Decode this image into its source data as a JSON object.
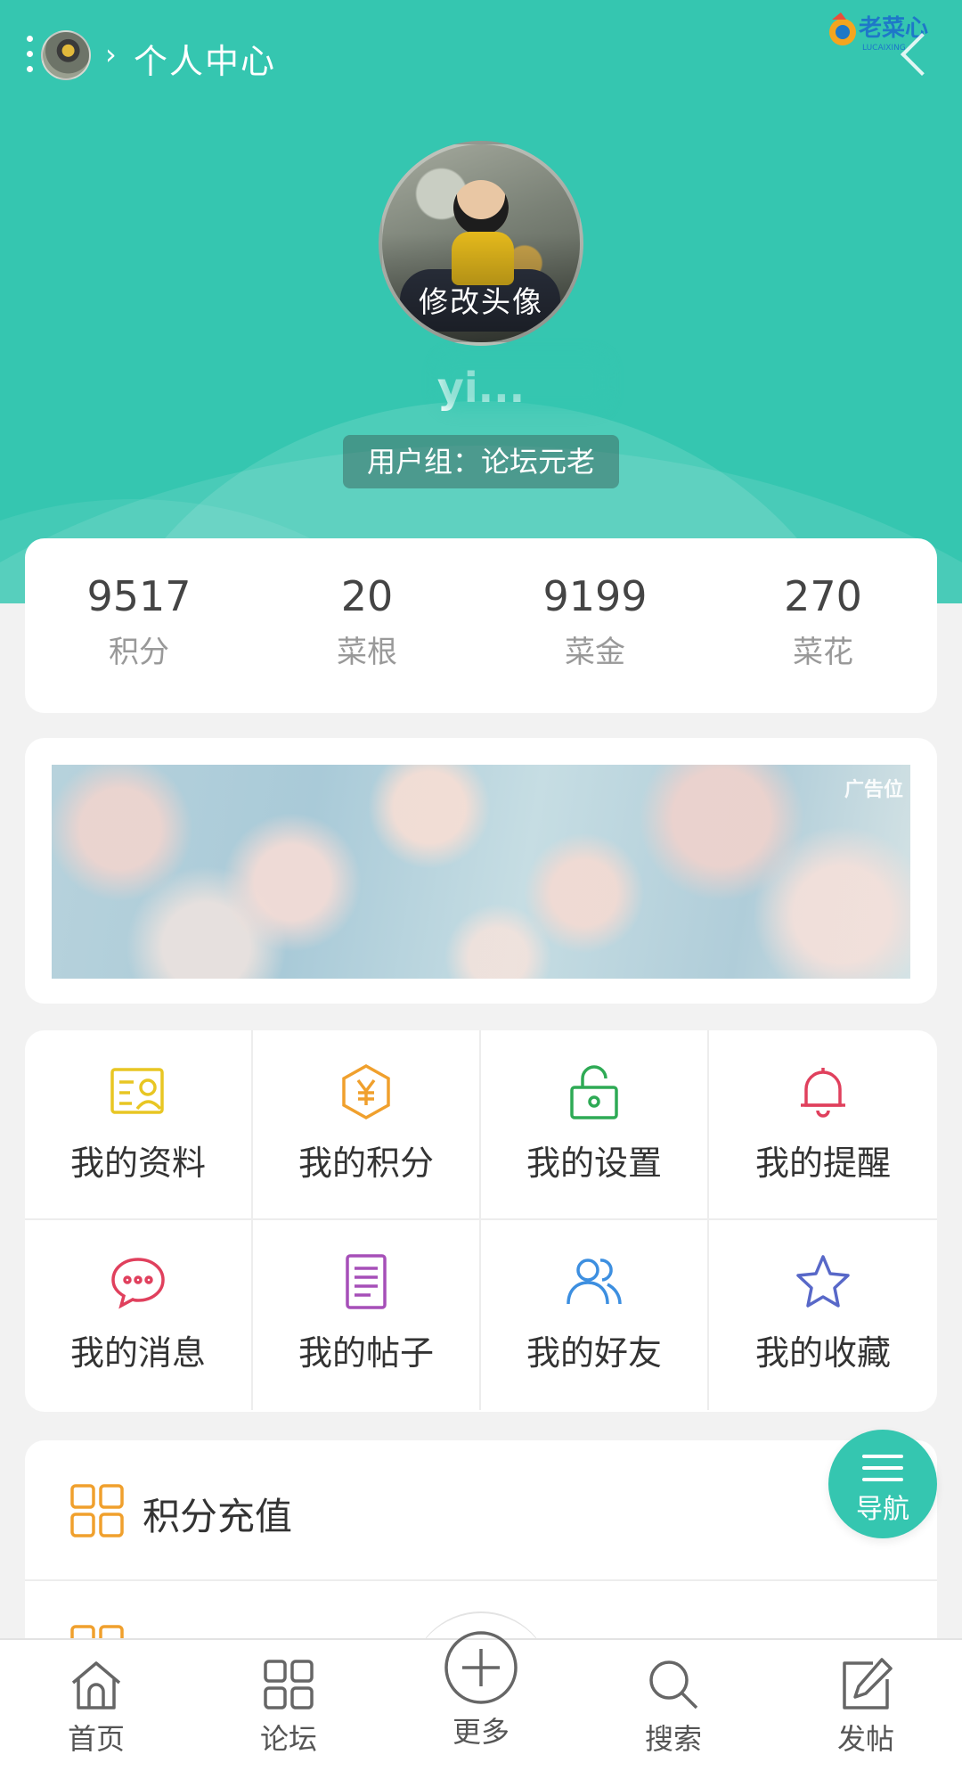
{
  "header": {
    "breadcrumb_sep": "›",
    "title": "个人中心",
    "logo_text": "老菜心",
    "logo_sub": "LUCAIXING"
  },
  "profile": {
    "avatar_label": "修改头像",
    "username": "yi...",
    "group": "用户组：论坛元老"
  },
  "stats": [
    {
      "value": "9517",
      "label": "积分"
    },
    {
      "value": "20",
      "label": "菜根"
    },
    {
      "value": "9199",
      "label": "菜金"
    },
    {
      "value": "270",
      "label": "菜花"
    }
  ],
  "ad": {
    "tag": "广告位"
  },
  "menu": [
    {
      "label": "我的资料",
      "icon": "profile-card-icon",
      "color": "#e8c623"
    },
    {
      "label": "我的积分",
      "icon": "yuan-hexagon-icon",
      "color": "#f0a02d"
    },
    {
      "label": "我的设置",
      "icon": "lock-icon",
      "color": "#2eaa55"
    },
    {
      "label": "我的提醒",
      "icon": "bell-icon",
      "color": "#e0405d"
    },
    {
      "label": "我的消息",
      "icon": "chat-bubble-icon",
      "color": "#e0405d"
    },
    {
      "label": "我的帖子",
      "icon": "document-icon",
      "color": "#a64fb8"
    },
    {
      "label": "我的好友",
      "icon": "friends-icon",
      "color": "#3d8fe0"
    },
    {
      "label": "我的收藏",
      "icon": "star-icon",
      "color": "#5868c8"
    }
  ],
  "list": [
    {
      "label": "积分充值",
      "icon": "grid-icon",
      "color": "#f0a02d"
    },
    {
      "label": "",
      "icon": "grid-icon",
      "color": "#f0a02d"
    }
  ],
  "fab": {
    "label": "导航"
  },
  "tabs": [
    {
      "label": "首页",
      "icon": "home-icon"
    },
    {
      "label": "论坛",
      "icon": "forum-grid-icon"
    },
    {
      "label": "更多",
      "icon": "plus-circle-icon"
    },
    {
      "label": "搜索",
      "icon": "search-icon"
    },
    {
      "label": "发帖",
      "icon": "compose-icon"
    }
  ],
  "colors": {
    "brand": "#35c6b0",
    "background": "#f2f2f2"
  }
}
